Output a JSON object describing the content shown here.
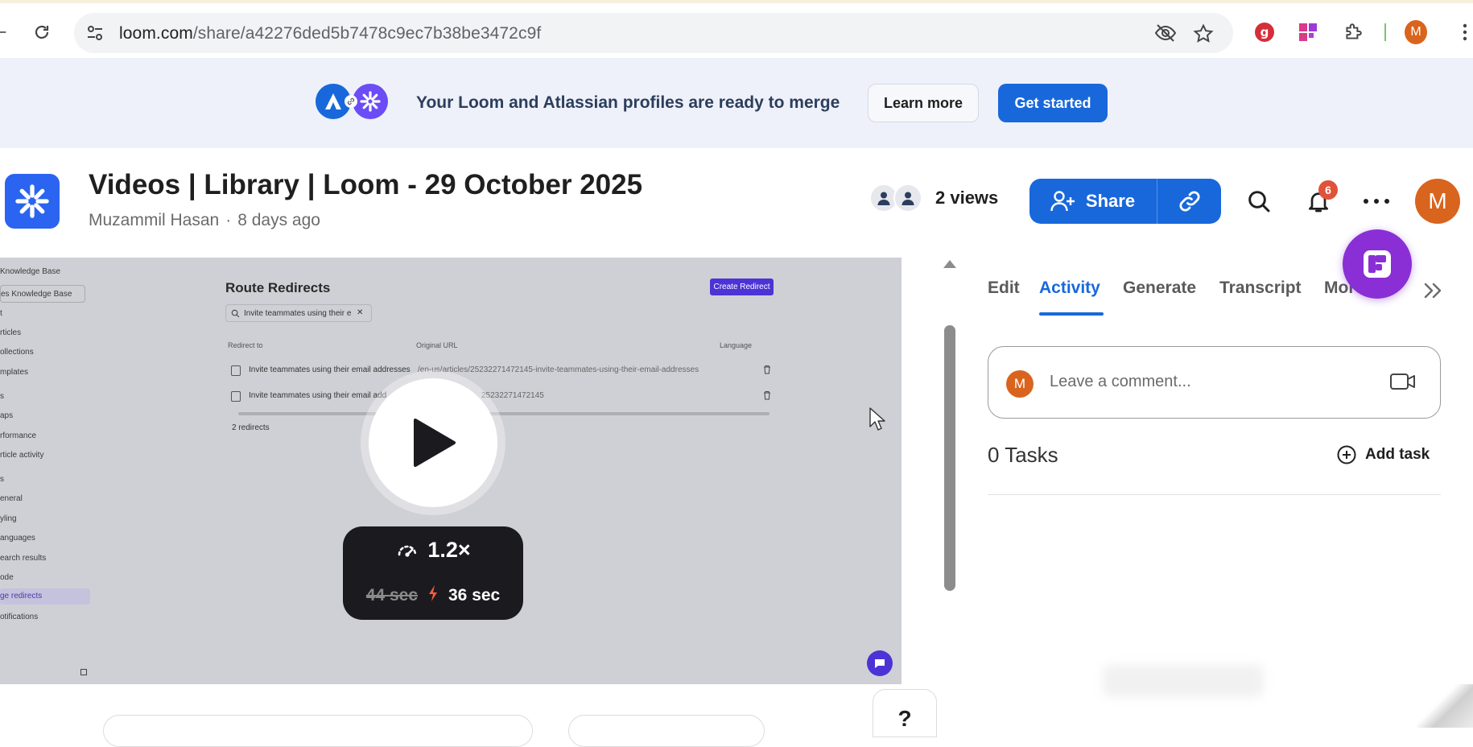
{
  "browser": {
    "url_host": "loom.com",
    "url_path": "/share/a42276ded5b7478c9ec7b38be3472c9f",
    "profile_initial": "M",
    "icons": [
      "back-icon",
      "reload-icon",
      "site-settings-icon",
      "eye-off-icon",
      "star-icon",
      "grammarly-extension-icon",
      "figma-extension-icon",
      "extensions-puzzle-icon",
      "more-vertical-icon"
    ]
  },
  "banner": {
    "text": "Your Loom and Atlassian profiles are ready to merge",
    "learn_more": "Learn more",
    "get_started": "Get started",
    "colors": {
      "atlassian": "#1868db",
      "loom": "#6b4cf6"
    }
  },
  "header": {
    "title": "Videos | Library | Loom - 29 October 2025",
    "author": "Muzammil Hasan",
    "separator": "·",
    "time_ago": "8 days ago",
    "views": "2 views",
    "share_label": "Share",
    "notification_count": "6",
    "avatar_initial": "M",
    "accent": "#1868db"
  },
  "video": {
    "page_title": "Route Redirects",
    "create_button": "Create Redirect",
    "search_value": "Invite teammates using their e",
    "col_redirect_to": "Redirect to",
    "col_original_url": "Original URL",
    "col_language": "Language",
    "rows": [
      {
        "redirect_to": "Invite teammates using their email addresses",
        "original_url": "/en-us/articles/25232271472145-invite-teammates-using-their-email-addresses"
      },
      {
        "redirect_to": "Invite teammates using their email add",
        "original_url": "25232271472145"
      }
    ],
    "count": "2 redirects",
    "sidebar": {
      "kb_header": "Knowledge Base",
      "kb_select": "es Knowledge Base",
      "items": [
        "t",
        "rticles",
        "ollections",
        "mplates",
        "s",
        "aps",
        "rformance",
        "rticle activity",
        "s",
        "eneral",
        "yling",
        "anguages",
        "earch results",
        "ode",
        "ge redirects",
        "otifications"
      ]
    },
    "speed": "1.2×",
    "original_time": "44 sec",
    "new_time": "36 sec"
  },
  "panel": {
    "tabs": [
      "Edit",
      "Activity",
      "Generate",
      "Transcript",
      "More"
    ],
    "active_tab": "Activity",
    "comment_placeholder": "Leave a comment...",
    "comment_avatar": "M",
    "tasks_label": "0 Tasks",
    "add_task": "Add task"
  },
  "help": {
    "label": "?"
  }
}
